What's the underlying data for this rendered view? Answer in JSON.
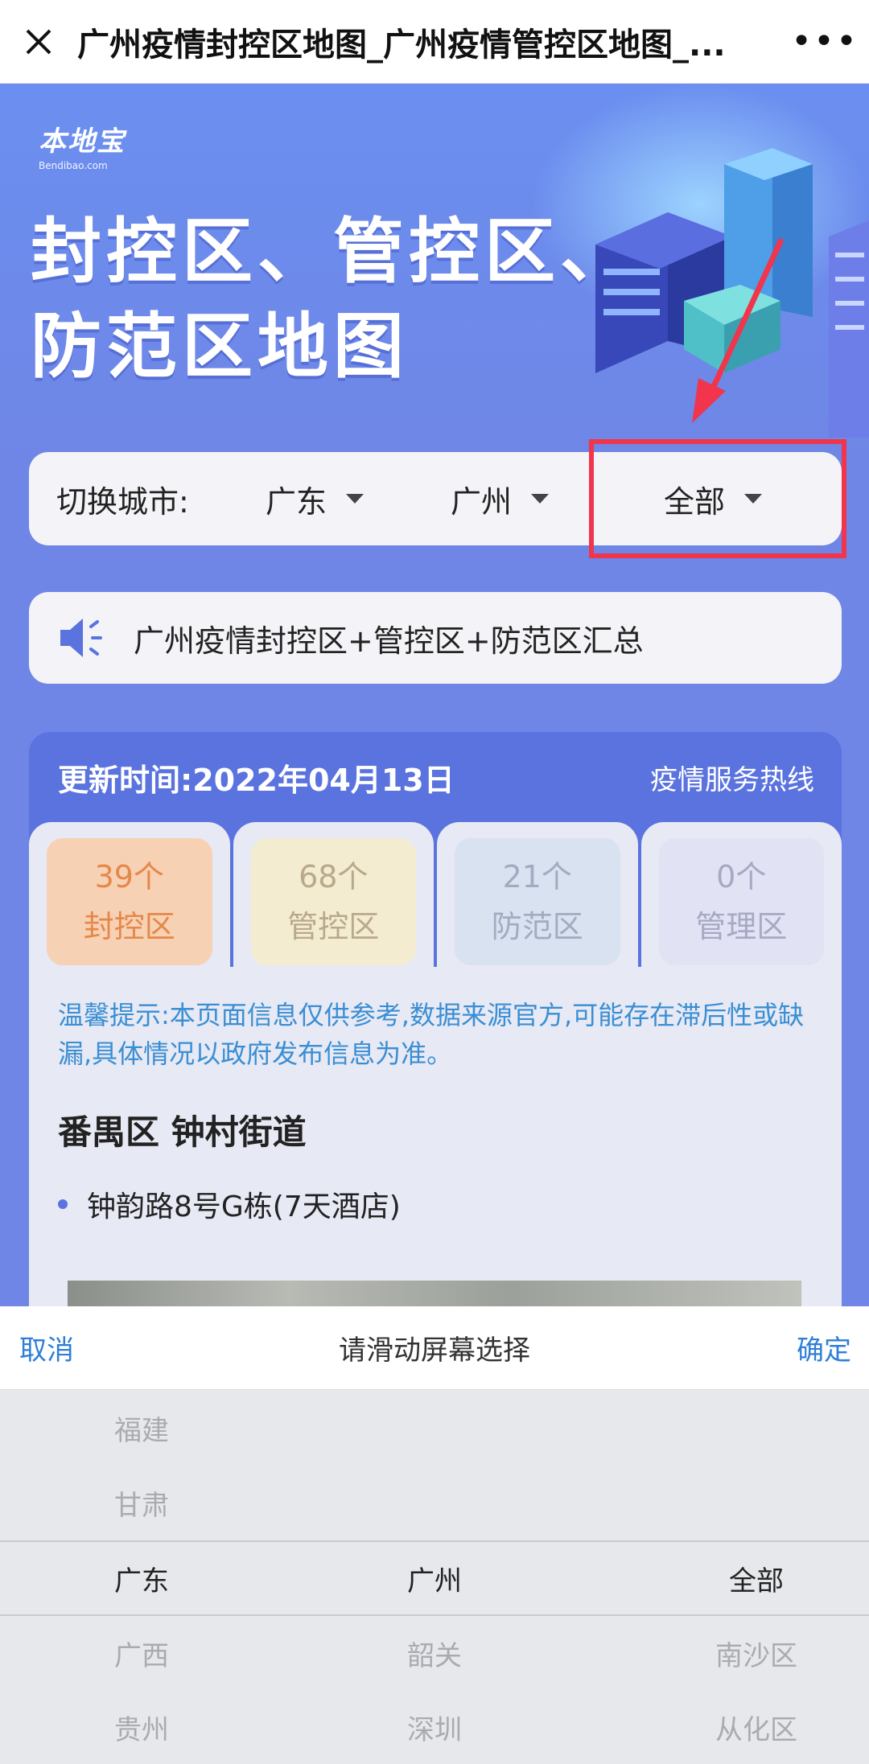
{
  "topbar": {
    "title": "广州疫情封控区地图_广州疫情管控区地图_...",
    "more": "•••"
  },
  "hero": {
    "logo_main": "本地宝",
    "logo_sub": "Bendibao.com",
    "title_line1": "封控区、管控区、",
    "title_line2": "防范区地图"
  },
  "city_switcher": {
    "label": "切换城市:",
    "province": "广东",
    "city": "广州",
    "district": "全部"
  },
  "notice": {
    "text": "广州疫情封控区+管控区+防范区汇总"
  },
  "info": {
    "update_time": "更新时间:2022年04月13日",
    "hotline": "疫情服务热线",
    "tabs": [
      {
        "count": "39个",
        "label": "封控区"
      },
      {
        "count": "68个",
        "label": "管控区"
      },
      {
        "count": "21个",
        "label": "防范区"
      },
      {
        "count": "0个",
        "label": "管理区"
      }
    ],
    "tip": "温馨提示:本页面信息仅供参考,数据来源官方,可能存在滞后性或缺漏,具体情况以政府发布信息为准。",
    "district": "番禺区 钟村街道",
    "places": [
      "钟韵路8号G栋(7天酒店)"
    ]
  },
  "picker": {
    "cancel": "取消",
    "prompt": "请滑动屏幕选择",
    "confirm": "确定",
    "provinces": [
      "福建",
      "甘肃",
      "广东",
      "广西",
      "贵州"
    ],
    "cities": [
      "广州",
      "韶关",
      "深圳"
    ],
    "districts": [
      "全部",
      "南沙区",
      "从化区"
    ]
  },
  "colors": {
    "accent_blue": "#5b73df",
    "highlight_red": "#f0354d",
    "link_blue": "#2f7fd6",
    "tip_blue": "#3a8ed3"
  }
}
